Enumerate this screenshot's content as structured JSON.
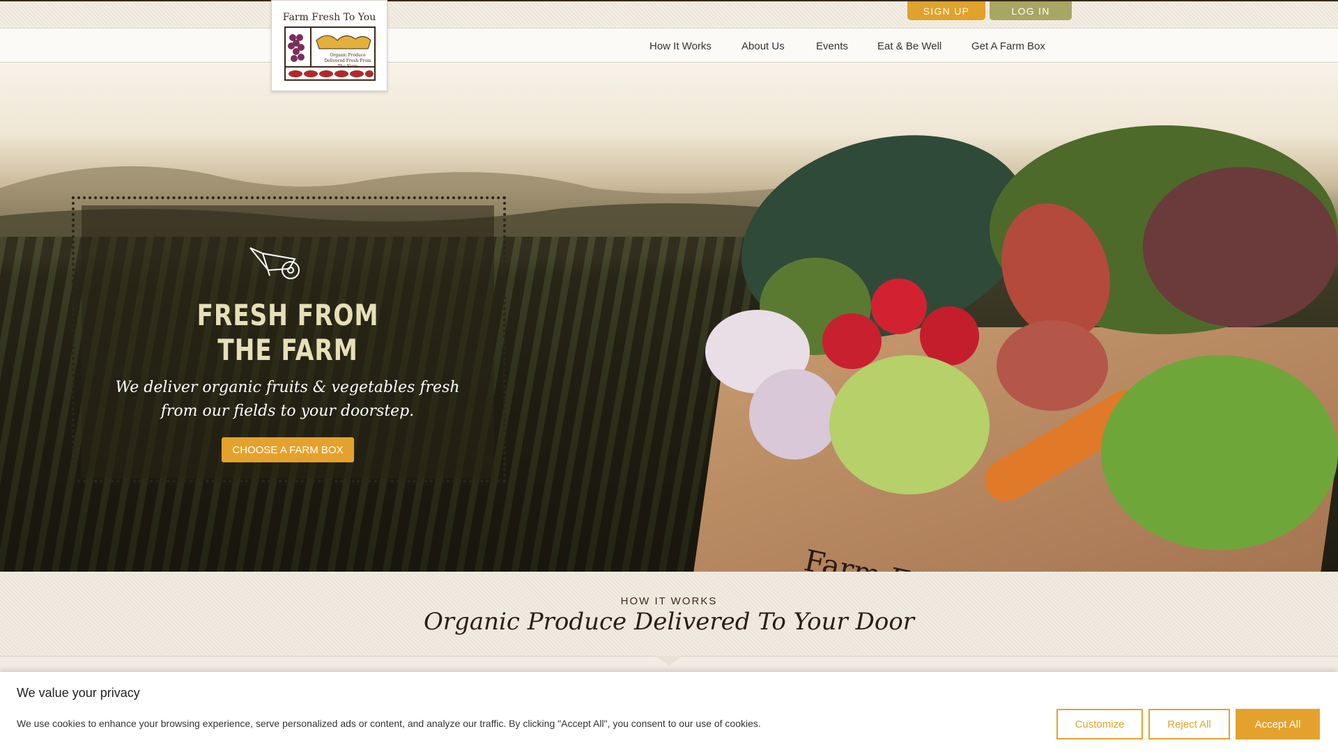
{
  "header": {
    "signup_label": "SIGN UP",
    "login_label": "LOG IN"
  },
  "logo": {
    "title": "Farm Fresh To You",
    "tagline": "Organic Produce Delivered Fresh From The Farm"
  },
  "nav": {
    "items": [
      {
        "label": "How It Works"
      },
      {
        "label": "About Us"
      },
      {
        "label": "Events"
      },
      {
        "label": "Eat & Be Well"
      },
      {
        "label": "Get A Farm Box"
      }
    ]
  },
  "hero": {
    "title_line1": "FRESH FROM",
    "title_line2": "THE FARM",
    "subtitle": "We deliver organic fruits & vegetables fresh from our fields to your doorstep.",
    "cta_label": "CHOOSE A FARM BOX",
    "box_text": "Farm Fresh To You",
    "icon": "wheelbarrow-icon"
  },
  "how_it_works": {
    "kicker": "HOW IT WORKS",
    "title": "Organic Produce Delivered To Your Door"
  },
  "cookie": {
    "title": "We value your privacy",
    "text": "We use cookies to enhance your browsing experience, serve personalized ads or content, and analyze our traffic. By clicking \"Accept All\", you consent to our use of cookies.",
    "customize_label": "Customize",
    "reject_label": "Reject All",
    "accept_label": "Accept All"
  },
  "colors": {
    "accent": "#e4a22c",
    "login_green": "#a9a663",
    "hero_title": "#e6dfb8"
  }
}
